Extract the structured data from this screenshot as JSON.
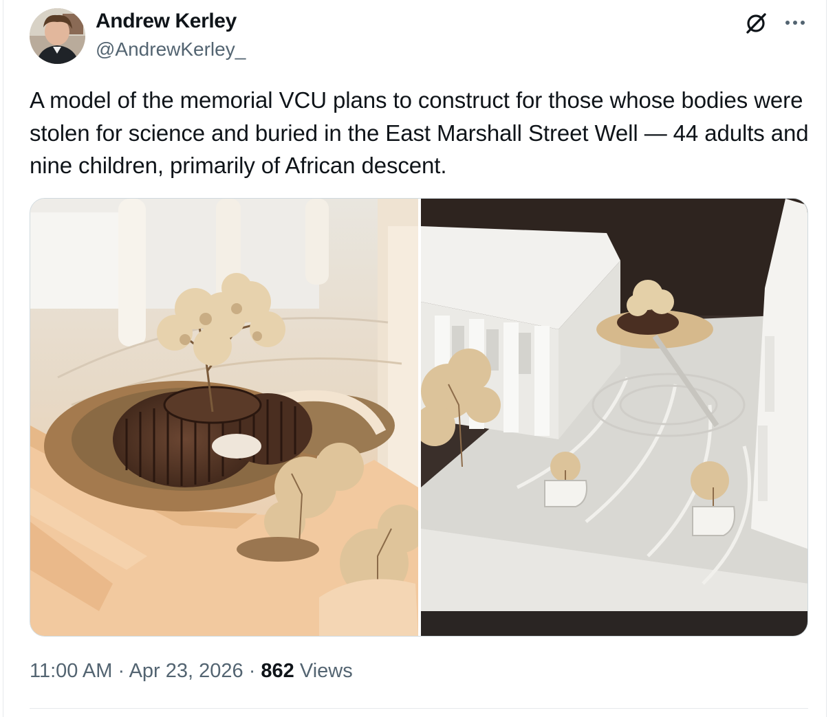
{
  "author": {
    "name": "Andrew Kerley",
    "handle": "@AndrewKerley_",
    "avatar_icon": "profile-photo"
  },
  "actions": {
    "grok_icon": "grok-icon",
    "more_icon": "more-icon"
  },
  "tweet": {
    "text": "A model of the memorial VCU plans to construct for those whose bodies were stolen for science and buried in the East Marshall Street Well — 44 adults and nine children, primarily of African descent."
  },
  "media": {
    "count": 2
  },
  "meta": {
    "time": "11:00 AM",
    "separator1": " · ",
    "date": "Apr 23, 2026",
    "separator2": " · ",
    "views_count": "862",
    "views_label": " Views"
  },
  "colors": {
    "text": "#0f1419",
    "secondary": "#536471",
    "border": "#cfd9de"
  }
}
